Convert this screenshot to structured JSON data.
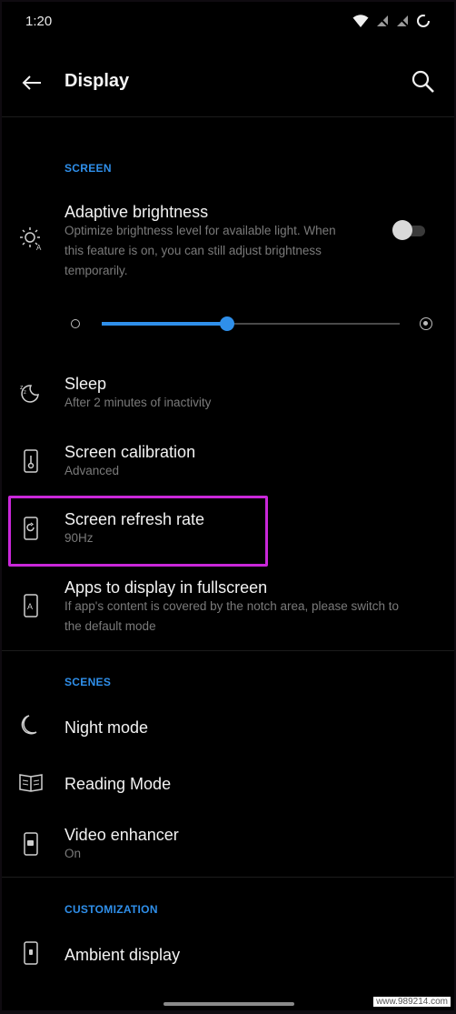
{
  "status_bar": {
    "time": "1:20"
  },
  "app_bar": {
    "title": "Display"
  },
  "sections": {
    "screen": "SCREEN",
    "scenes": "SCENES",
    "customization": "CUSTOMIZATION"
  },
  "items": {
    "adaptive_brightness": {
      "title": "Adaptive brightness",
      "subtitle_line1": "Optimize brightness level for available light. When",
      "subtitle_line2": "this feature is on, you can still adjust brightness",
      "subtitle_line3": "temporarily.",
      "toggle_on": false
    },
    "brightness_slider": {
      "level_fraction": 0.42
    },
    "sleep": {
      "title": "Sleep",
      "subtitle": "After 2 minutes of inactivity"
    },
    "screen_calibration": {
      "title": "Screen calibration",
      "subtitle": "Advanced"
    },
    "screen_refresh_rate": {
      "title": "Screen refresh rate",
      "subtitle": "90Hz"
    },
    "fullscreen_apps": {
      "title": "Apps to display in fullscreen",
      "subtitle_line1": "If app's content is covered by the notch area, please switch to",
      "subtitle_line2": "the default mode"
    },
    "night_mode": {
      "title": "Night mode"
    },
    "reading_mode": {
      "title": "Reading Mode"
    },
    "video_enhancer": {
      "title": "Video enhancer",
      "subtitle": "On"
    },
    "ambient_display": {
      "title": "Ambient display"
    }
  },
  "watermark": "www.989214.com",
  "colors": {
    "accent": "#2f8fea",
    "highlight": "#c927d9",
    "background": "#000000"
  },
  "icons": {
    "back": "arrow-left-icon",
    "search": "search-icon",
    "adaptive_brightness": "brightness-auto-icon",
    "sleep": "sleep-icon",
    "screen_calibration": "thermometer-phone-icon",
    "screen_refresh_rate": "refresh-phone-icon",
    "fullscreen_apps": "fullscreen-app-icon",
    "night_mode": "moon-icon",
    "reading_mode": "book-icon",
    "video_enhancer": "video-phone-icon",
    "ambient_display": "ambient-phone-icon"
  }
}
